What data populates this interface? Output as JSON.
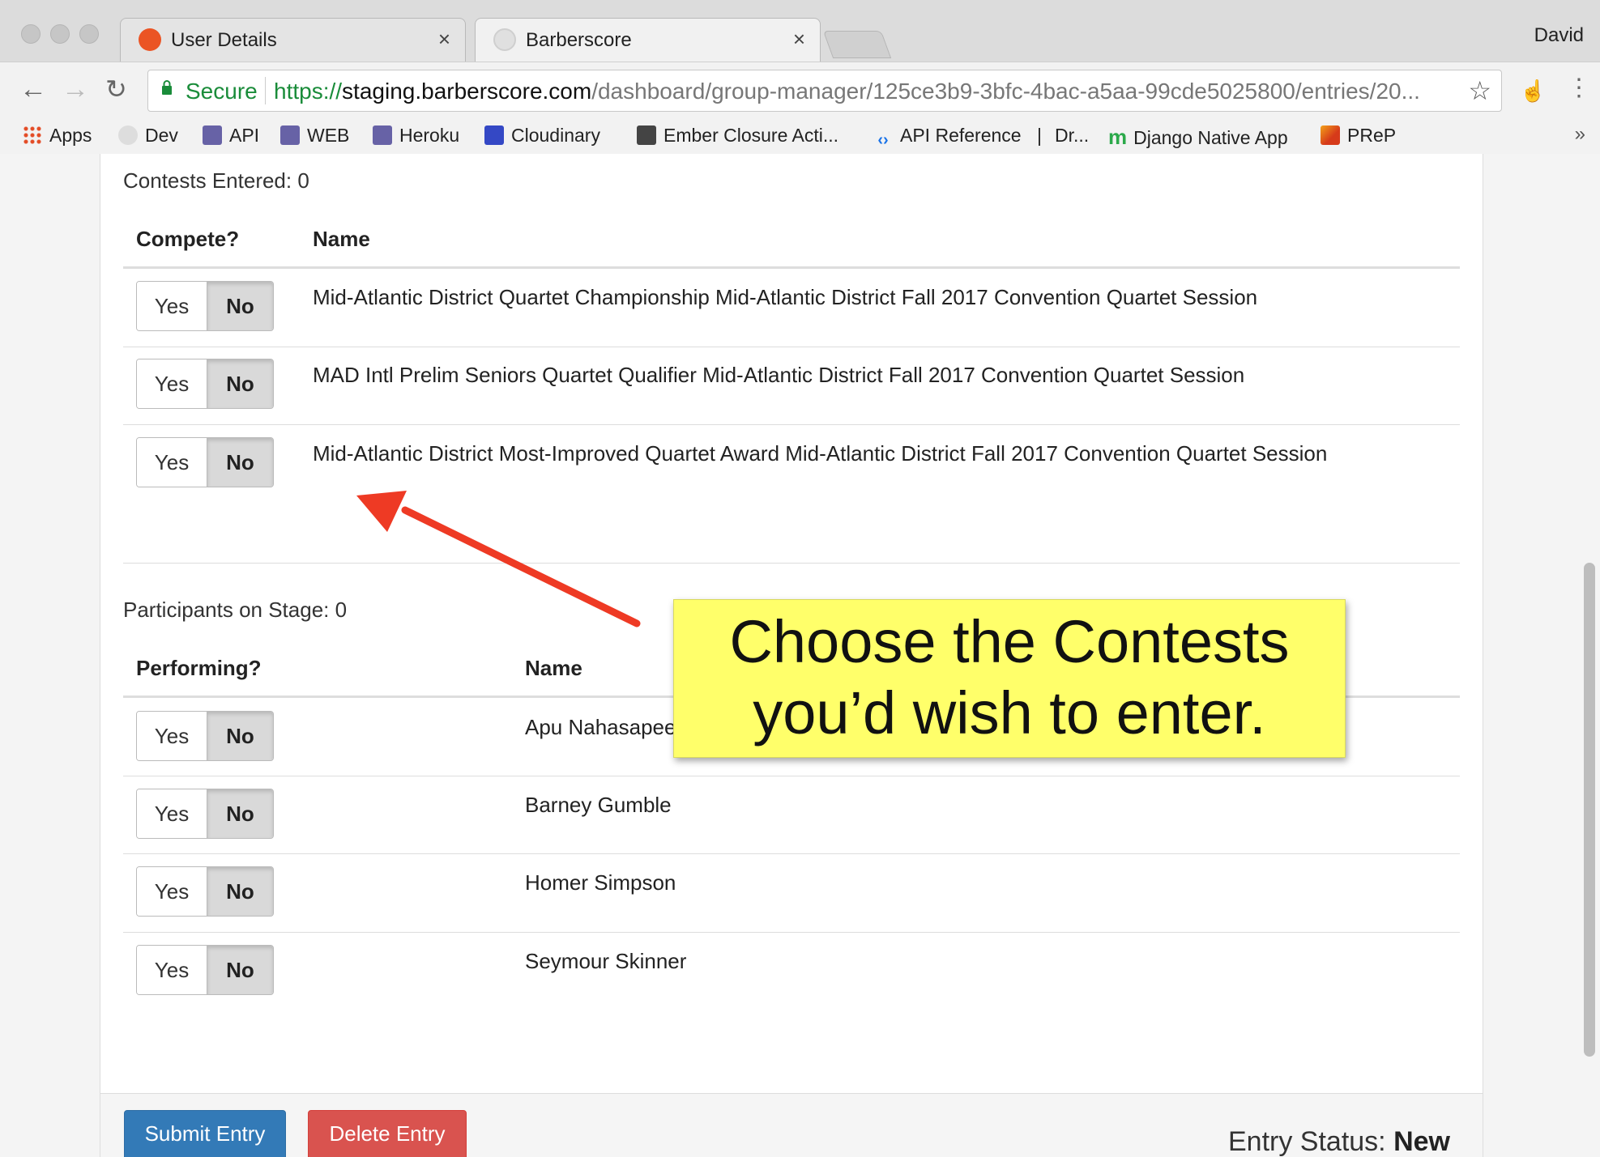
{
  "browser": {
    "tabs": [
      {
        "title": "User Details",
        "icon": "auth0-icon",
        "close": "×"
      },
      {
        "title": "Barberscore",
        "icon": "barberscore-icon",
        "close": "×"
      }
    ],
    "profile_name": "David",
    "secure_label": "Secure",
    "url": {
      "scheme": "https://",
      "host": "staging.barberscore.com",
      "path": "/dashboard/group-manager/125ce3b9-3bfc-4bac-a5aa-99cde5025800/entries/20..."
    },
    "bookmarks": [
      {
        "label": "Apps",
        "icon": "apps-grid-icon",
        "color": "#e34c26"
      },
      {
        "label": "Dev",
        "icon": "globe-icon",
        "color": "#bbbbbb"
      },
      {
        "label": "API",
        "icon": "heroku-icon",
        "color": "#6762a6"
      },
      {
        "label": "WEB",
        "icon": "heroku-icon",
        "color": "#6762a6"
      },
      {
        "label": "Heroku",
        "icon": "heroku-icon",
        "color": "#6762a6"
      },
      {
        "label": "Cloudinary",
        "icon": "cloudinary-icon",
        "color": "#3448c5"
      },
      {
        "label": "Ember Closure Acti...",
        "icon": "ember-icon",
        "color": "#444444"
      },
      {
        "label": "API Reference",
        "icon": "code-icon",
        "color": "#1a73e8"
      },
      {
        "label": "Dr...",
        "icon": "",
        "color": ""
      },
      {
        "label": "Django Native App",
        "icon": "django-m-icon",
        "color": "#2ba94a"
      },
      {
        "label": "PReP",
        "icon": "prep-icon",
        "color": "#d63a1a"
      }
    ],
    "bookmark_separator": "|",
    "bookmarks_more": "»"
  },
  "contests": {
    "count_label": "Contests Entered: 0",
    "header_compete": "Compete?",
    "header_name": "Name",
    "rows": [
      {
        "yes": "Yes",
        "no": "No",
        "name": "Mid-Atlantic District Quartet Championship Mid-Atlantic District Fall 2017 Convention Quartet Session"
      },
      {
        "yes": "Yes",
        "no": "No",
        "name": "MAD Intl Prelim Seniors Quartet Qualifier Mid-Atlantic District Fall 2017 Convention Quartet Session"
      },
      {
        "yes": "Yes",
        "no": "No",
        "name": "Mid-Atlantic District Most-Improved Quartet Award Mid-Atlantic District Fall 2017 Convention Quartet Session"
      }
    ]
  },
  "participants": {
    "count_label": "Participants on Stage: 0",
    "header_performing": "Performing?",
    "header_name": "Name",
    "rows": [
      {
        "yes": "Yes",
        "no": "No",
        "name": "Apu Nahasapeemapetilon"
      },
      {
        "yes": "Yes",
        "no": "No",
        "name": "Barney Gumble"
      },
      {
        "yes": "Yes",
        "no": "No",
        "name": "Homer Simpson"
      },
      {
        "yes": "Yes",
        "no": "No",
        "name": "Seymour Skinner"
      }
    ]
  },
  "footer": {
    "submit_label": "Submit Entry",
    "delete_label": "Delete Entry",
    "status_prefix": "Entry Status:",
    "status_value": "New"
  },
  "callout": {
    "text": "Choose the Contests\nyou’d wish to enter."
  },
  "colors": {
    "secure_green": "#1a8c3a",
    "submit_blue": "#337ab7",
    "delete_red": "#d9534f",
    "callout_yellow": "#ffff6a",
    "arrow_red": "#ee3a24"
  }
}
